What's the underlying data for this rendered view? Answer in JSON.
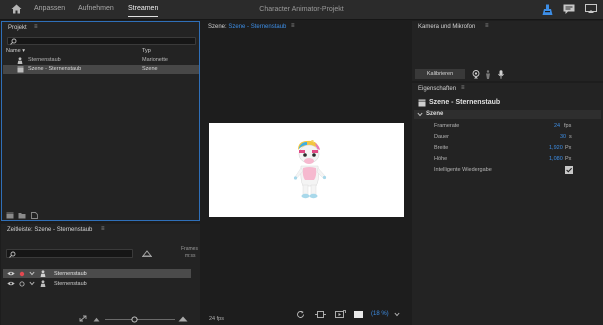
{
  "topbar": {
    "tabs": [
      "Anpassen",
      "Aufnehmen",
      "Streamen"
    ],
    "active_tab": "Streamen",
    "app_title": "Character Animator-Projekt"
  },
  "project": {
    "title": "Projekt",
    "columns": {
      "name": "Name",
      "type": "Typ"
    },
    "items": [
      {
        "name": "Sternenstaub",
        "type": "Marionette"
      },
      {
        "name": "Szene - Sternenstaub",
        "type": "Szene"
      }
    ]
  },
  "scene": {
    "title_prefix": "Szene:",
    "title_name": "Szene - Sternenstaub",
    "fps": "24 fps",
    "zoom": "(18 %)"
  },
  "camera": {
    "title": "Kamera und Mikrofon",
    "calibrate_label": "Kalibrieren"
  },
  "properties": {
    "title": "Eigenschaften",
    "scene_name": "Szene - Sternenstaub",
    "section": "Szene",
    "rows": [
      {
        "label": "Framerate",
        "value": "24",
        "unit": "fps"
      },
      {
        "label": "Dauer",
        "value": "30",
        "unit": "s"
      },
      {
        "label": "Breite",
        "value": "1,920",
        "unit": "Px"
      },
      {
        "label": "Höhe",
        "value": "1,080",
        "unit": "Px"
      }
    ],
    "smart_replay_label": "Intelligente Wiedergabe",
    "smart_replay_checked": true
  },
  "timeline": {
    "title": "Zeitleiste: Szene - Sternenstaub",
    "frame_label": "Frames",
    "time_unit": "m:ss",
    "tracks": [
      {
        "name": "Sternenstaub"
      },
      {
        "name": "Sternenstaub"
      }
    ]
  },
  "colors": {
    "accent_blue": "#3d8ee6",
    "record_red": "#e34850",
    "panel_border_active": "#2f6fb8"
  }
}
